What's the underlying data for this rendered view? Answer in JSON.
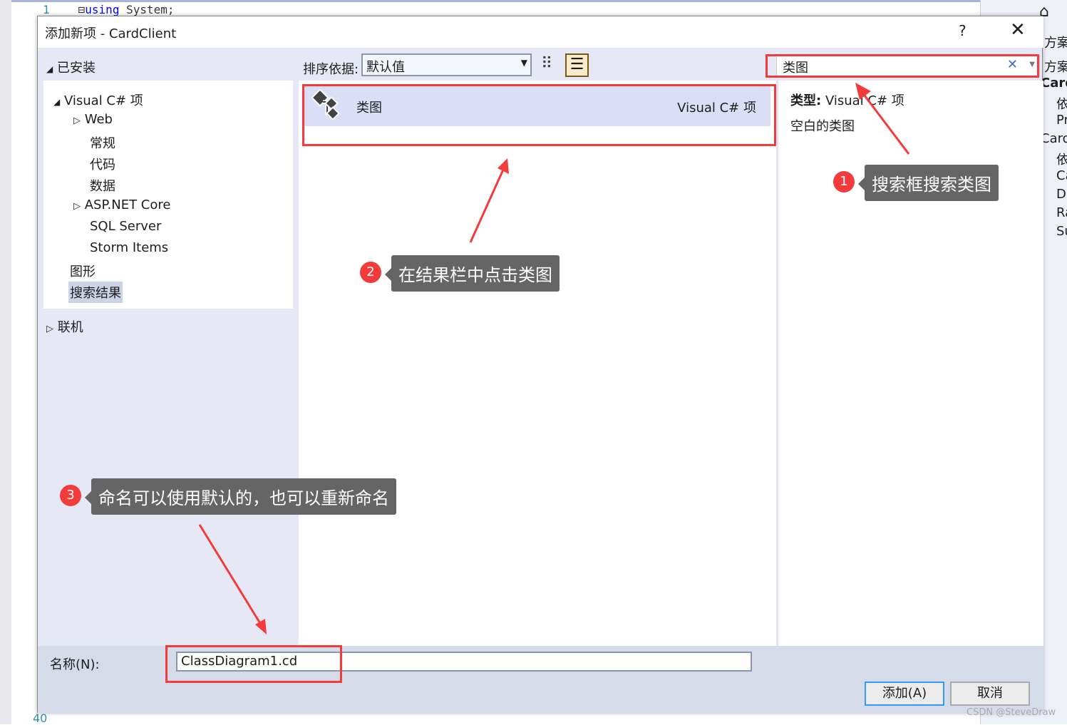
{
  "editor": {
    "line1_number": "1",
    "line1_keyword": "using",
    "line1_rest": " System;",
    "line40_number": "40"
  },
  "side_panel": {
    "items": [
      "方案资",
      "方案",
      "Card",
      "依",
      "Pr",
      "Card",
      "依",
      "Ca",
      "D",
      "Ra",
      "Su"
    ]
  },
  "dialog": {
    "title": "添加新项 - CardClient",
    "help_label": "?",
    "close_label": "✕",
    "installed_label": "已安装",
    "tree": [
      {
        "label": "Visual C# 项",
        "expander": "expanded"
      },
      {
        "label": "Web",
        "expander": "collapsed"
      },
      {
        "label": "常规"
      },
      {
        "label": "代码"
      },
      {
        "label": "数据"
      },
      {
        "label": "ASP.NET Core",
        "expander": "collapsed"
      },
      {
        "label": "SQL Server"
      },
      {
        "label": "Storm Items"
      },
      {
        "label": "图形"
      },
      {
        "label": "搜索结果",
        "selected": true
      }
    ],
    "online_label": "联机",
    "sort_label": "排序依据:",
    "sort_value": "默认值",
    "search_value": "类图",
    "search_clear": "✕",
    "results": [
      {
        "name": "类图",
        "type": "Visual C# 项",
        "icon": "class-diagram-icon"
      }
    ],
    "details": {
      "type_label": "类型:",
      "type_value": "Visual C# 项",
      "description": "空白的类图"
    },
    "name_label": "名称(N):",
    "name_value": "ClassDiagram1.cd",
    "add_button": "添加(A)",
    "cancel_button": "取消"
  },
  "annotations": [
    {
      "number": "1",
      "text": "搜索框搜索类图"
    },
    {
      "number": "2",
      "text": "在结果栏中点击类图"
    },
    {
      "number": "3",
      "text": "命名可以使用默认的，也可以重新命名"
    }
  ],
  "watermark": "CSDN @SteveDraw",
  "colors": {
    "annotation_red": "#f33b3b",
    "callout_bg": "#656565",
    "selection": "#dadff7",
    "add_border": "#3399ff"
  }
}
